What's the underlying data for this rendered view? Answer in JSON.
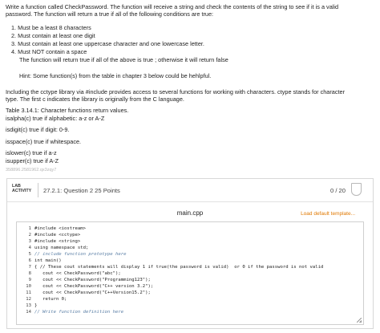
{
  "intro": {
    "line1": "Write a function called CheckPassword. The function will receive a string and check the contents of the string to see if it is a valid",
    "line2": "password. The function will return a true if all of the following conditions are true:"
  },
  "conditions": [
    "1. Must be a least 8 characters",
    "2. Must contain at least one digit",
    "3. Must contain at least one uppercase character and one lowercase letter.",
    "4. Must NOT contain a space"
  ],
  "return_note": "The function will return true if all of the above is true ; otherwise it will return false",
  "hint": "Hint: Some function(s) from the table in chapter 3 below could be hehlpful.",
  "cctype": {
    "line1": "Including the cctype library via #include provides access to several functions for working with characters. ctype stands for character",
    "line2": "type. The first c indicates the library is originally from the C language."
  },
  "table": {
    "caption": "Table 3.14.1: Character functions return values.",
    "rows": [
      "isalpha(c) true if alphabetic: a-z or A-Z",
      "isdigit(c) true if digit: 0-9.",
      "isspace(c) true if whitespace.",
      "islower(c) true if a-z",
      "isupper(c) true if A-Z"
    ]
  },
  "watermark": "358896.2581962.qx3zqy7",
  "lab": {
    "badge_line1": "LAB",
    "badge_line2": "ACTIVITY",
    "title": "27.2.1: Question 2 25 Points",
    "score": "0 / 20",
    "filename": "main.cpp",
    "load_default": "Load default template..."
  },
  "code_lines": [
    {
      "n": "1",
      "text": "#include <iostream>"
    },
    {
      "n": "2",
      "text": "#include <cctype>"
    },
    {
      "n": "3",
      "text": "#include <string>"
    },
    {
      "n": "4",
      "text": "using namespace std;"
    },
    {
      "n": "5",
      "text": "// include function prototype here"
    },
    {
      "n": "6",
      "text": "int main()"
    },
    {
      "n": "7",
      "text": "{ // These cout statements will display 1 if true(the password is valid)  or 0 if the password is not valid"
    },
    {
      "n": "8",
      "text": "   cout << CheckPassword(\"abc\");"
    },
    {
      "n": "9",
      "text": "   cout << CheckPassword(\"Programming123\");"
    },
    {
      "n": "10",
      "text": "   cout << CheckPassword(\"C++ version 3.2\");"
    },
    {
      "n": "11",
      "text": "   cout << CheckPassword(\"C++Version15.2\");"
    },
    {
      "n": "12",
      "text": "   return 0;"
    },
    {
      "n": "13",
      "text": "}"
    },
    {
      "n": "14",
      "text": "// Write function definition here"
    }
  ],
  "colors": {
    "accent": "#e07800",
    "border": "#d0d0d0"
  }
}
